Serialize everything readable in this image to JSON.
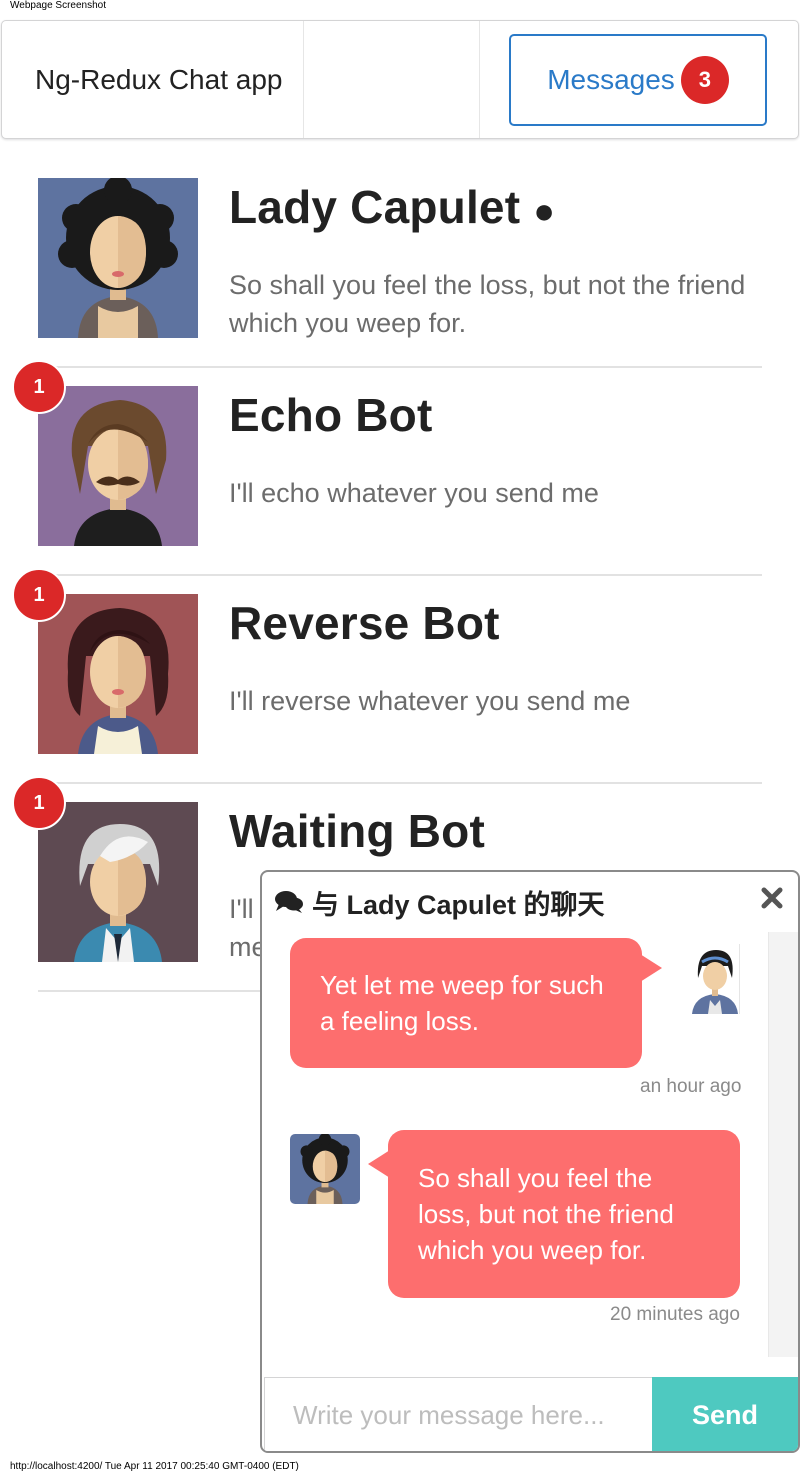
{
  "page": {
    "caption": "Webpage Screenshot",
    "footer": "http://localhost:4200/ Tue Apr 11 2017 00:25:40 GMT-0400 (EDT)"
  },
  "nav": {
    "brand": "Ng-Redux Chat app",
    "messages_label": "Messages",
    "messages_count": "3"
  },
  "threads": [
    {
      "name": "Lady Capulet",
      "online_dot": "●",
      "snippet": "So shall you feel the loss, but not the friend which you weep for.",
      "unread": "",
      "avatar": "avatar-lady-capulet"
    },
    {
      "name": "Echo Bot",
      "snippet": "I'll echo whatever you send me",
      "unread": "1",
      "avatar": "avatar-echo-bot"
    },
    {
      "name": "Reverse Bot",
      "snippet": "I'll reverse whatever you send me",
      "unread": "1",
      "avatar": "avatar-reverse-bot"
    },
    {
      "name": "Waiting Bot",
      "snippet": "I'll wait however many seconds you send to me",
      "unread": "1",
      "avatar": "avatar-waiting-bot"
    }
  ],
  "chat": {
    "title": "与 Lady Capulet 的聊天",
    "header_icon": "comments-icon",
    "close_icon": "close-icon",
    "messages": [
      {
        "text": "Yet let me weep for such a feeling loss.",
        "time": "an hour ago",
        "from": "me"
      },
      {
        "text": "So shall you feel the loss, but not the friend which you weep for.",
        "time": "20 minutes ago",
        "from": "Lady Capulet"
      }
    ],
    "input_placeholder": "Write your message here...",
    "send_label": "Send"
  },
  "colors": {
    "accent_blue": "#2a7ac8",
    "badge_red": "#db2828",
    "bubble": "#fd6e6e",
    "send_teal": "#4ec9c0"
  }
}
